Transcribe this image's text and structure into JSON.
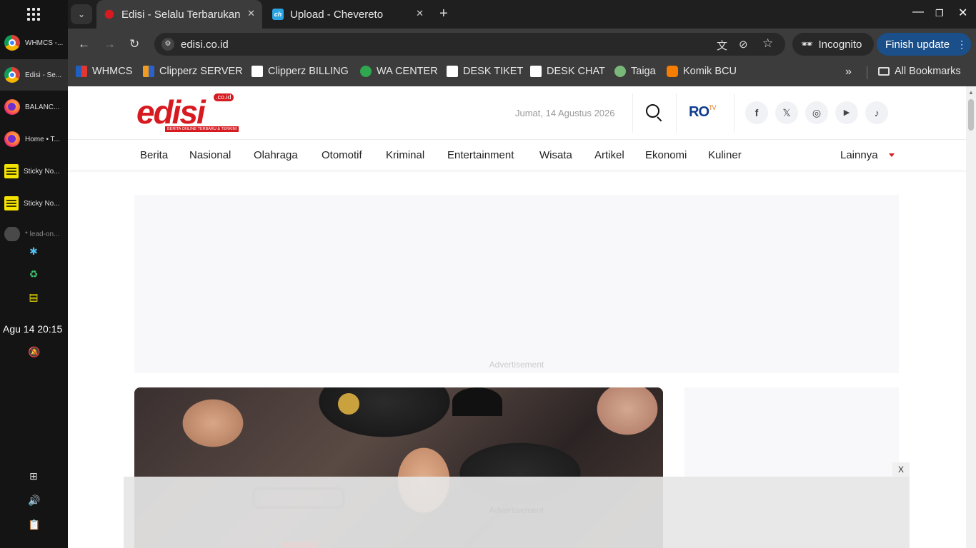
{
  "taskbar": {
    "windows": [
      {
        "label": "WHMCS -...",
        "icon": "chrome-icon"
      },
      {
        "label": "Edisi - Se...",
        "icon": "chrome-icon"
      },
      {
        "label": "BALANC...",
        "icon": "firefox-icon"
      },
      {
        "label": "Home • T...",
        "icon": "firefox-icon"
      },
      {
        "label": "Sticky No...",
        "icon": "sticky-notes-icon"
      },
      {
        "label": "Sticky No...",
        "icon": "sticky-notes-icon"
      },
      {
        "label": "* lead-on...",
        "icon": "globe-icon"
      }
    ],
    "clock": "Agu 14  20:15"
  },
  "browser": {
    "tabs": [
      {
        "title": "Edisi - Selalu Terbarukan",
        "active": true
      },
      {
        "title": "Upload - Chevereto",
        "active": false
      }
    ],
    "url": "edisi.co.id",
    "incognito_label": "Incognito",
    "finish_update_label": "Finish update",
    "bookmarks": [
      {
        "label": "WHMCS"
      },
      {
        "label": "Clipperz SERVER"
      },
      {
        "label": "Clipperz BILLING"
      },
      {
        "label": "WA CENTER"
      },
      {
        "label": "DESK TIKET"
      },
      {
        "label": "DESK CHAT"
      },
      {
        "label": "Taiga"
      },
      {
        "label": "Komik BCU"
      }
    ],
    "all_bookmarks_label": "All Bookmarks"
  },
  "site": {
    "logo": {
      "word": "edisi",
      "suffix": ".co.id",
      "tagline": "BERITA ONLINE TERBARU & TERKINI"
    },
    "date": "Jumat, 14 Agustus 2026",
    "rotv_logo": {
      "main": "RO",
      "sub": "TV"
    },
    "nav": [
      "Berita",
      "Nasional",
      "Olahraga",
      "Otomotif",
      "Kriminal",
      "Entertainment",
      "Wisata",
      "Artikel",
      "Ekonomi",
      "Kuliner"
    ],
    "more_label": "Lainnya",
    "ad_label_top": "Advertisement",
    "ad_label_bottom": "Advertisement",
    "ad_close": "X"
  },
  "colors": {
    "brand": "#d71920",
    "update_button": "#1a4f8a"
  }
}
